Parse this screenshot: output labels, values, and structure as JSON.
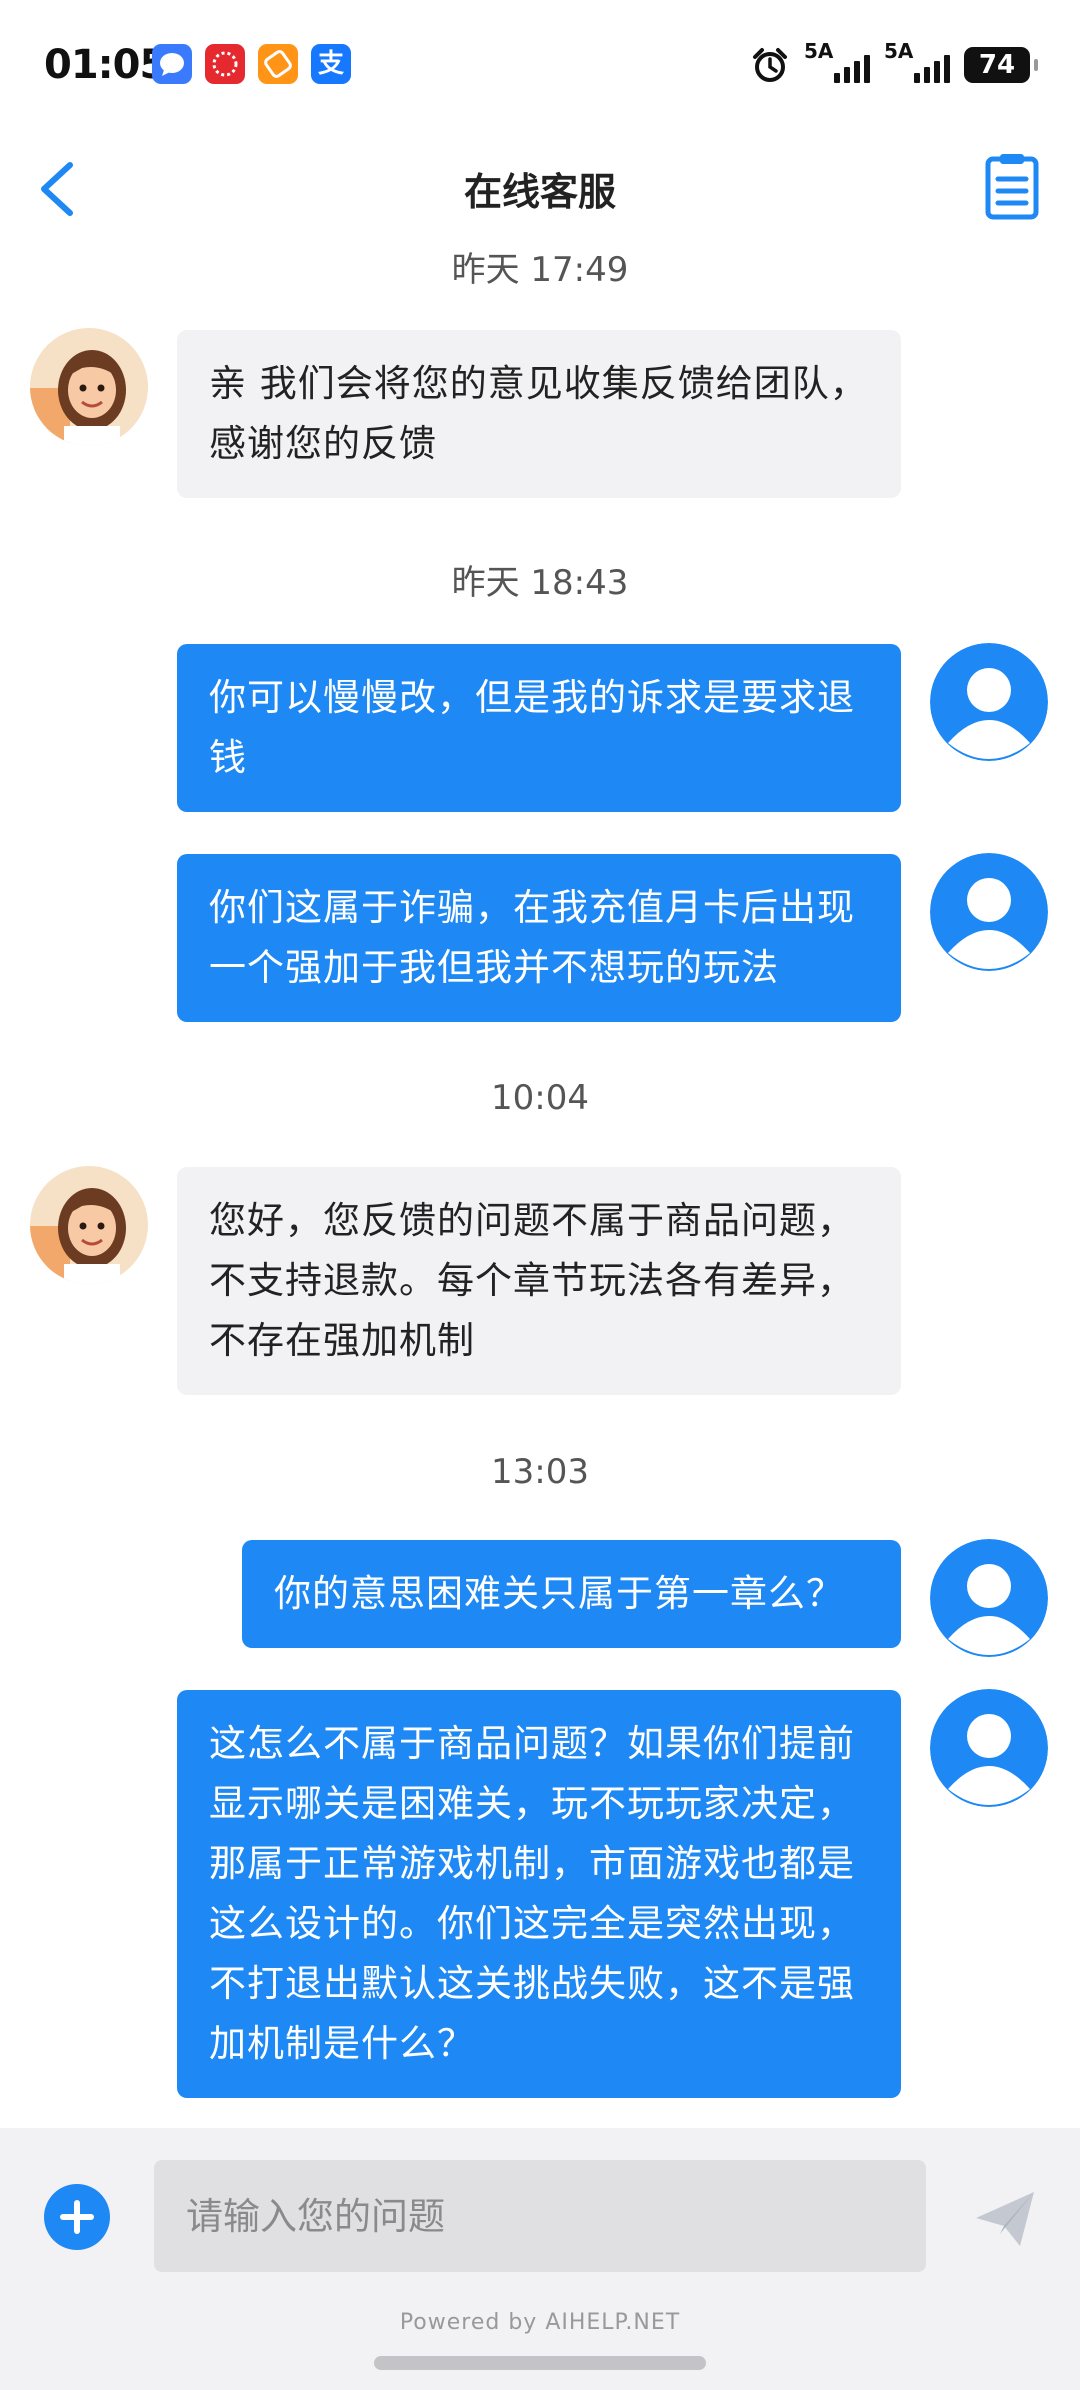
{
  "status_bar": {
    "time": "01:05",
    "app_icons": [
      "message-icon",
      "shopping-icon",
      "ticket-icon",
      "alipay-icon"
    ],
    "alipay_char": "支",
    "signal1": "5A",
    "signal2": "5A",
    "battery": "74"
  },
  "header": {
    "title": "在线客服"
  },
  "messages": [
    {
      "type": "timestamp",
      "text": "昨天 17:49"
    },
    {
      "type": "agent",
      "text": "亲 我们会将您的意见收集反馈给团队，感谢您的反馈"
    },
    {
      "type": "timestamp",
      "text": "昨天 18:43"
    },
    {
      "type": "user",
      "text": "你可以慢慢改，但是我的诉求是要求退钱"
    },
    {
      "type": "user",
      "text": "你们这属于诈骗，在我充值月卡后出现一个强加于我但我并不想玩的玩法"
    },
    {
      "type": "timestamp",
      "text": "10:04"
    },
    {
      "type": "agent",
      "text": "您好，您反馈的问题不属于商品问题，不支持退款。每个章节玩法各有差异，不存在强加机制"
    },
    {
      "type": "timestamp",
      "text": "13:03"
    },
    {
      "type": "user",
      "text": "你的意思困难关只属于第一章么？"
    },
    {
      "type": "user",
      "text": "这怎么不属于商品问题？如果你们提前显示哪关是困难关，玩不玩玩家决定，那属于正常游戏机制，市面游戏也都是这么设计的。你们这完全是突然出现，不打退出默认这关挑战失败，这不是强加机制是什么？"
    }
  ],
  "composer": {
    "placeholder": "请输入您的问题",
    "powered_by": "Powered by AIHELP.NET"
  },
  "colors": {
    "accent": "#1e88f5",
    "incoming_bubble": "#f2f2f4",
    "page_bg": "#ffffff"
  }
}
